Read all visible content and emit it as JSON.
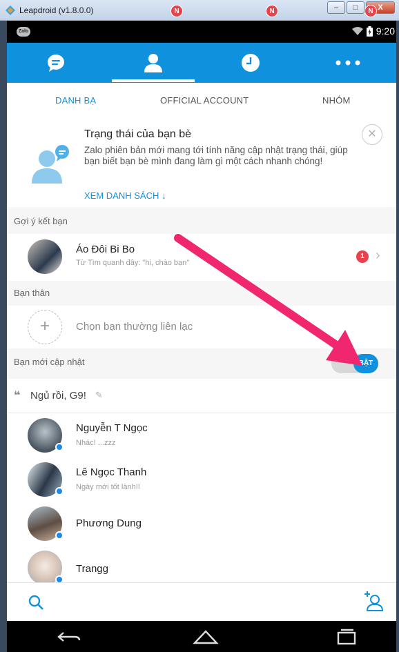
{
  "window": {
    "title": "Leapdroid (v1.8.0.0)",
    "minimize": "–",
    "maximize": "□",
    "close": "X"
  },
  "statusbar": {
    "app_label": "Zalo",
    "time": "9:20"
  },
  "appbar": {
    "tabs": [
      {
        "icon": "chat-icon",
        "badge": ""
      },
      {
        "icon": "contacts-icon",
        "badge": "N"
      },
      {
        "icon": "clock-icon",
        "badge": "N"
      },
      {
        "icon": "more-icon",
        "badge": "N"
      }
    ],
    "accent": "#0f91de"
  },
  "subtabs": {
    "contacts": "DANH BẠ",
    "official": "OFFICIAL ACCOUNT",
    "groups": "NHÓM"
  },
  "banner": {
    "title": "Trạng thái của bạn bè",
    "body": "Zalo phiên bản mới mang tới tính năng cập nhật trạng thái, giúp bạn biết bạn bè mình đang làm gì một cách nhanh chóng!",
    "link": "XEM DANH SÁCH ↓"
  },
  "suggest": {
    "label": "Gợi ý kết bạn",
    "name": "Áo Đôi Bi Bo",
    "sub": "Từ Tìm quanh đây: \"hi, chào bạn\"",
    "count": "1"
  },
  "close_friends": {
    "label": "Bạn thân",
    "prompt": "Chọn bạn thường liên lạc"
  },
  "updates": {
    "label": "Bạn mới cập nhật",
    "toggle": "BẬT"
  },
  "my_status": {
    "text": "Ngủ rồi, G9!"
  },
  "contacts": [
    {
      "name": "Nguyễn T Ngọc",
      "status": "Nhác! ...zzz"
    },
    {
      "name": "Lê Ngọc Thanh",
      "status": "Ngày mới tốt lành!!"
    },
    {
      "name": "Phương Dung",
      "status": ""
    },
    {
      "name": "Trangg",
      "status": ""
    }
  ]
}
